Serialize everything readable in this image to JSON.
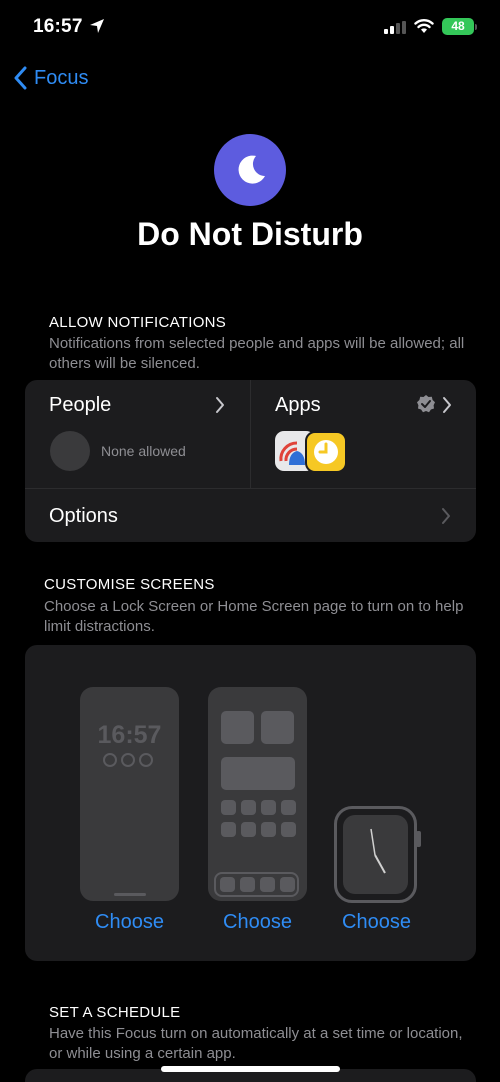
{
  "status_bar": {
    "time": "16:57",
    "battery": "48"
  },
  "nav": {
    "back_label": "Focus"
  },
  "page": {
    "title": "Do Not Disturb"
  },
  "allow_notifications": {
    "header": "ALLOW NOTIFICATIONS",
    "description": "Notifications from selected people and apps will be allowed; all others will be silenced.",
    "people_label": "People",
    "people_status": "None allowed",
    "apps_label": "Apps",
    "options_label": "Options"
  },
  "customise_screens": {
    "header": "CUSTOMISE SCREENS",
    "description": "Choose a Lock Screen or Home Screen page to turn on to help limit distractions.",
    "lock_preview_time": "16:57",
    "choose_lock": "Choose",
    "choose_home": "Choose",
    "choose_watch": "Choose"
  },
  "schedule": {
    "header": "SET A SCHEDULE",
    "description": "Have this Focus turn on automatically at a set time or location, or while using a certain app."
  },
  "colors": {
    "accent": "#2f8cf4",
    "focus_icon": "#5d5cdf",
    "battery": "#34c759",
    "card": "#1c1c1e"
  }
}
